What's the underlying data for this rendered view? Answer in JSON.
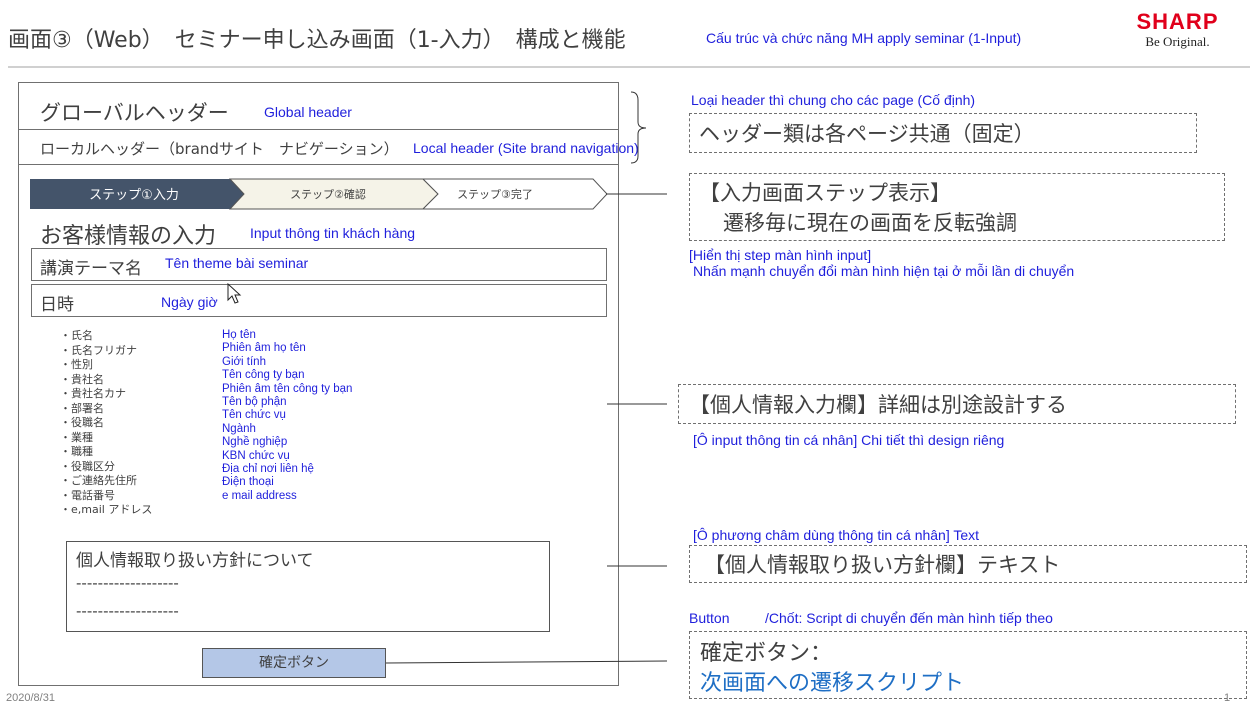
{
  "header": {
    "title": "画面③（Web）　セミナー申し込み画面（1-入力）　構成と機能",
    "title_vn": "Cấu trúc và chức năng MH apply seminar (1-Input)",
    "logo_word": "SHARP",
    "logo_tagline": "Be Original.",
    "logo_color": "#e0001b"
  },
  "mock": {
    "global_header": {
      "jp": "グローバルヘッダー",
      "en": "Global header"
    },
    "local_header": {
      "jp": "ローカルヘッダー（brandサイト　ナビゲーション）",
      "en": "Local header (Site brand navigation)"
    },
    "steps": [
      {
        "label": "ステップ①入力",
        "active": true
      },
      {
        "label": "ステップ②確認",
        "active": false
      },
      {
        "label": "ステップ③完了",
        "active": false
      }
    ],
    "form_title": {
      "jp": "お客様情報の入力",
      "vn": "Input thông tin khách hàng"
    },
    "theme_field": {
      "jp": "講演テーマ名",
      "vn": "Tên theme bài seminar"
    },
    "date_field": {
      "jp": "日時",
      "vn": "Ngày giờ"
    },
    "fields_jp": [
      "・氏名",
      "・氏名フリガナ",
      "・性別",
      "・貴社名",
      "・貴社名カナ",
      "・部署名",
      "・役職名",
      "・業種",
      "・職種",
      "・役職区分",
      "・ご連絡先住所",
      "・電話番号",
      "・e,mail アドレス"
    ],
    "fields_vn": [
      "Họ tên",
      "Phiên âm họ tên",
      "Giới tính",
      "Tên công ty bạn",
      "Phiên âm tên công ty bạn",
      "Tên bộ phận",
      "Tên chức vụ",
      "Ngành",
      "Nghề nghiệp",
      "KBN chức vụ",
      "Địa chỉ nơi liên hệ",
      "Điện thoại",
      "e mail address"
    ],
    "policy": {
      "title": "個人情報取り扱い方針について",
      "line1": "-------------------",
      "line2": "-------------------"
    },
    "confirm_button": "確定ボタン",
    "active_step_color": "#44546a",
    "button_color": "#b4c7e7"
  },
  "notes": {
    "header_vn": "Loại header thì chung cho các page (Cố định)",
    "header_jp": "ヘッダー類は各ページ共通（固定）",
    "steps_jp_1": "【入力画面ステップ表示】",
    "steps_jp_2": "遷移毎に現在の画面を反転強調",
    "steps_vn_1": "[Hiển thị step màn hình input]",
    "steps_vn_2": "Nhấn mạnh chuyển đổi màn hình hiện tại ở mỗi lần di chuyển",
    "personal_jp": "【個人情報入力欄】詳細は別途設計する",
    "personal_vn": "[Ô input thông tin cá nhân] Chi tiết thì design riêng",
    "policy_vn": "[Ô phương châm dùng thông tin cá nhân] Text",
    "policy_jp": "【個人情報取り扱い方針欄】テキスト",
    "button_vn_a": "Button",
    "button_vn_b": "/Chốt: Script di chuyển đến màn hình tiếp theo",
    "button_jp_1": "確定ボタン：",
    "button_jp_2": "次画面への遷移スクリプト",
    "annotation_color": "#1f1fdc"
  },
  "footer": {
    "date": "2020/8/31",
    "page": "1"
  }
}
